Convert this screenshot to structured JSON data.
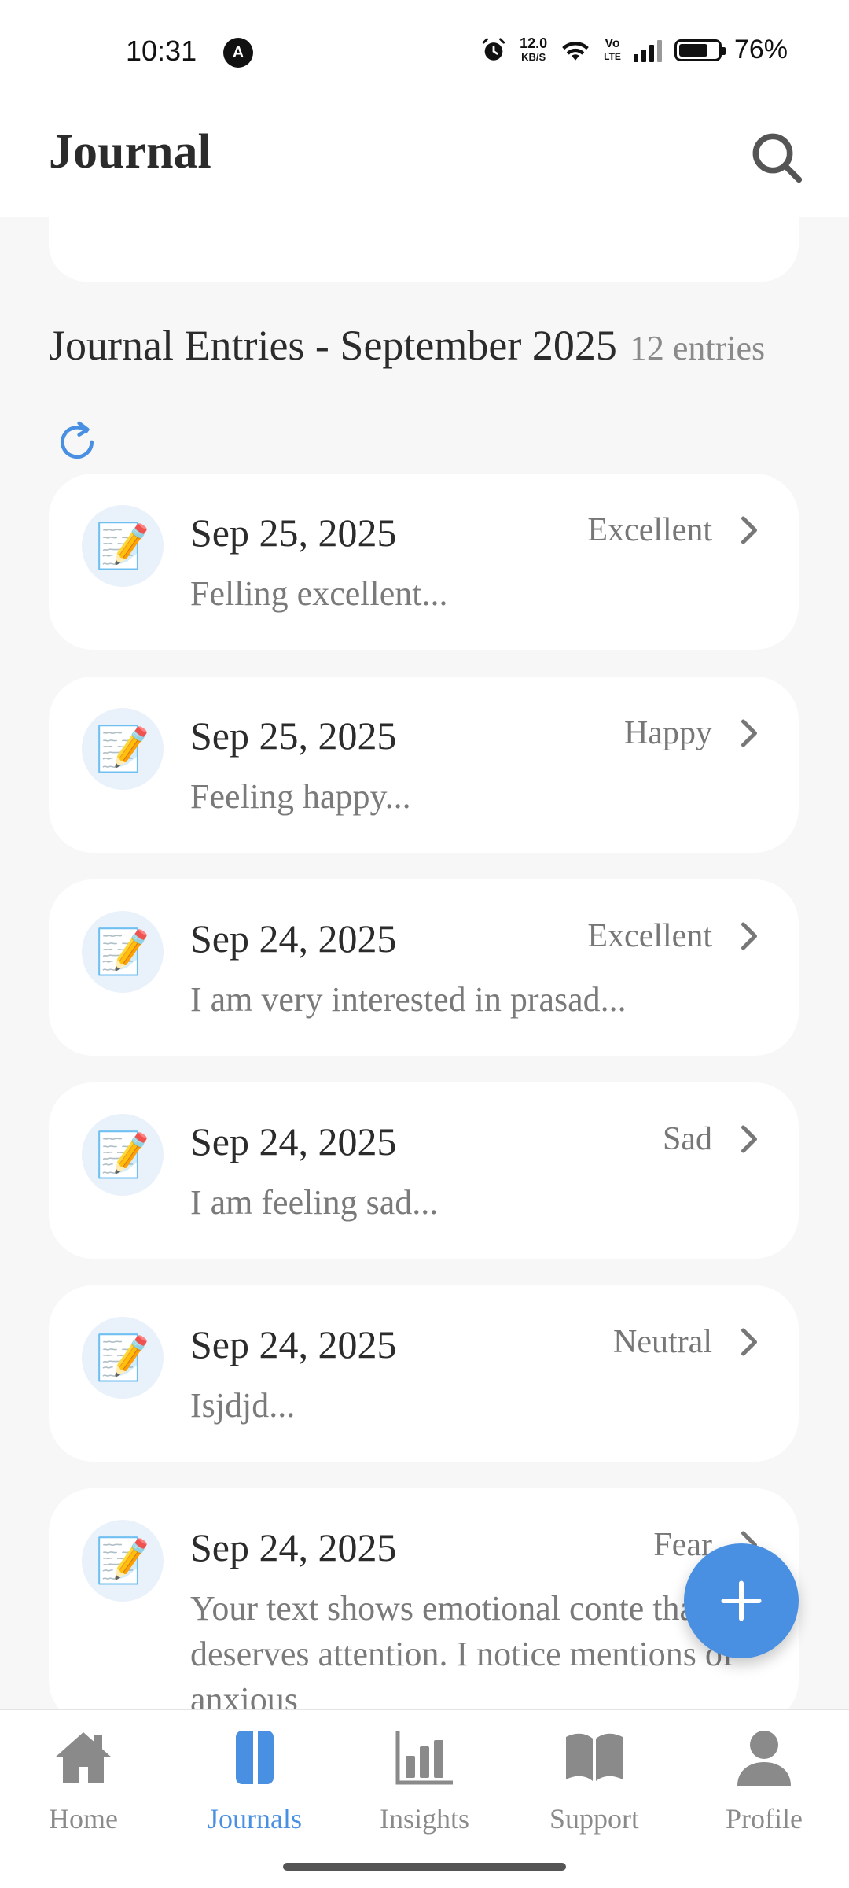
{
  "status_bar": {
    "time": "10:31",
    "avatar_letter": "A",
    "net_speed_value": "12.0",
    "net_speed_unit": "KB/S",
    "volte_top": "Vo",
    "volte_bottom": "LTE",
    "battery_percent": "76%",
    "battery_level": 0.76
  },
  "header": {
    "title": "Journal",
    "search_icon": "search-icon"
  },
  "section": {
    "title": "Journal Entries - September 2025",
    "count": "12 entries"
  },
  "entries": [
    {
      "date": "Sep 25, 2025",
      "mood": "Excellent",
      "preview": "Felling excellent...",
      "icon": "📝"
    },
    {
      "date": "Sep 25, 2025",
      "mood": "Happy",
      "preview": "Feeling happy...",
      "icon": "📝"
    },
    {
      "date": "Sep 24, 2025",
      "mood": "Excellent",
      "preview": "I am very interested in prasad...",
      "icon": "📝"
    },
    {
      "date": "Sep 24, 2025",
      "mood": "Sad",
      "preview": "I am feeling sad...",
      "icon": "📝"
    },
    {
      "date": "Sep 24, 2025",
      "mood": "Neutral",
      "preview": "Isjdjd...",
      "icon": "📝"
    },
    {
      "date": "Sep 24, 2025",
      "mood": "Fear",
      "preview": "Your text shows emotional conte that deserves attention. I notice mentions of anxious",
      "icon": "📝"
    }
  ],
  "fab": {
    "icon": "plus-icon"
  },
  "nav": {
    "items": [
      {
        "label": "Home",
        "icon": "home-icon",
        "active": false
      },
      {
        "label": "Journals",
        "icon": "journal-icon",
        "active": true
      },
      {
        "label": "Insights",
        "icon": "bar-chart-icon",
        "active": false
      },
      {
        "label": "Support",
        "icon": "book-icon",
        "active": false
      },
      {
        "label": "Profile",
        "icon": "person-icon",
        "active": false
      }
    ]
  },
  "colors": {
    "accent": "#4a90e2",
    "background": "#f7f7f7",
    "card": "#ffffff",
    "muted_text": "#7a7a7a",
    "inactive_icon": "#8a8a8a"
  }
}
